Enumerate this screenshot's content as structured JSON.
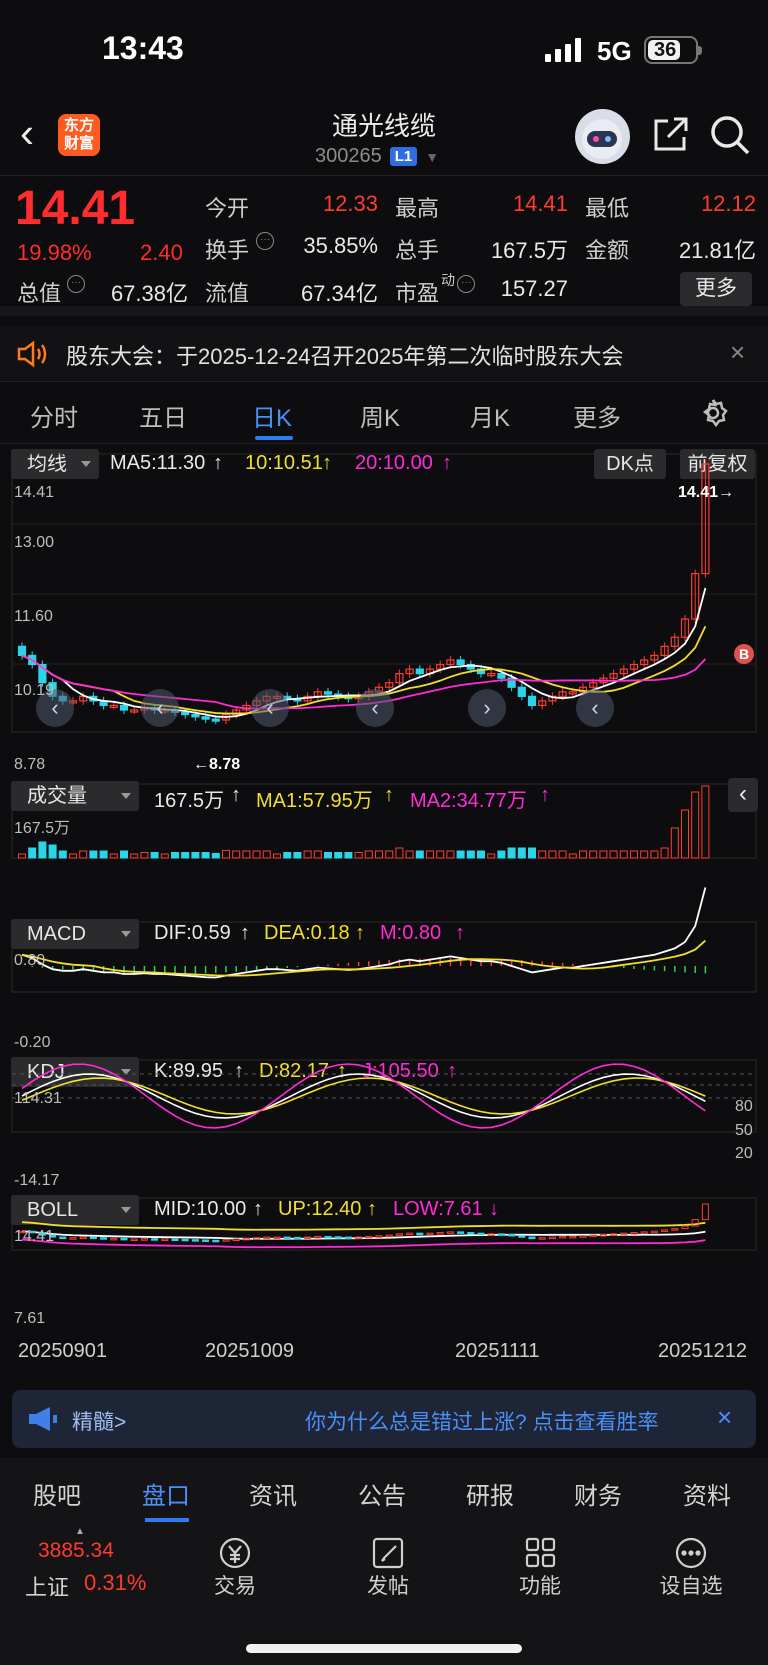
{
  "status": {
    "time": "13:43",
    "network": "5G",
    "battery": "36"
  },
  "header": {
    "title": "通光线缆",
    "code": "300265",
    "level": "L1",
    "logo_line1": "东方",
    "logo_line2": "财富"
  },
  "quote": {
    "price": "14.41",
    "pct": "19.98%",
    "change": "2.40",
    "labels": {
      "open": "今开",
      "high": "最高",
      "low": "最低",
      "turnover": "换手",
      "volume": "总手",
      "amount": "金额",
      "mktcap": "总值",
      "float": "流值",
      "pe": "市盈",
      "pe_sup": "动"
    },
    "values": {
      "open": "12.33",
      "high": "14.41",
      "low": "12.12",
      "turnover": "35.85%",
      "volume": "167.5万",
      "amount": "21.81亿",
      "mktcap": "67.38亿",
      "float": "67.34亿",
      "pe": "157.27"
    },
    "more": "更多"
  },
  "notice": {
    "text": "股东大会：于2025-12-24召开2025年第二次临时股东大会",
    "close": "×"
  },
  "tabs": [
    "分时",
    "五日",
    "日K",
    "周K",
    "月K",
    "更多"
  ],
  "tabs_active": 2,
  "kline": {
    "selector": "均线",
    "ma5": "MA5:11.30",
    "ma10": "10:10.51",
    "ma20": "20:10.00",
    "arrow": "↑",
    "dk": "DK点",
    "adj": "前复权",
    "y_top": "14.41",
    "y_mid1": "13.00",
    "y_mid2": "11.60",
    "y_mid3": "10.19",
    "y_bottom": "8.78",
    "hi_mark": "14.41",
    "lo_mark": "8.78",
    "b_mark": "B"
  },
  "volume": {
    "selector": "成交量",
    "vol": "167.5万",
    "ma1": "MA1:57.95万",
    "ma2": "MA2:34.77万",
    "y_top": "167.5万"
  },
  "macd": {
    "selector": "MACD",
    "dif": "DIF:0.59",
    "dea": "DEA:0.18",
    "m": "M:0.80",
    "y_top": "0.80",
    "y_bottom": "-0.20"
  },
  "kdj": {
    "selector": "KDJ",
    "k": "K:89.95",
    "d": "D:82.17",
    "j": "J:105.50",
    "y_top": "114.31",
    "y_bottom": "-14.17",
    "lv80": "80",
    "lv50": "50",
    "lv20": "20"
  },
  "boll": {
    "selector": "BOLL",
    "mid": "MID:10.00",
    "up": "UP:12.40",
    "low": "LOW:7.61",
    "low_arrow": "↓",
    "y_top": "14.41",
    "y_bottom": "7.61"
  },
  "dates": [
    "20250901",
    "20251009",
    "20251111",
    "20251212"
  ],
  "ad": {
    "left": "精髓>",
    "right": "你为什么总是错过上涨? 点击查看胜率",
    "close": "×"
  },
  "bottom_tabs": [
    "股吧",
    "盘口",
    "资讯",
    "公告",
    "研报",
    "财务",
    "资料"
  ],
  "bottom_tabs_active": 1,
  "bottom": {
    "index_value": "3885.34",
    "index_name": "上证",
    "index_pct": "0.31%",
    "actions": [
      "交易",
      "发帖",
      "功能",
      "设自选"
    ]
  },
  "colors": {
    "up": "#ff3b30",
    "down": "#2bd4e6",
    "ma5": "#ffffff",
    "ma10": "#f2df2c",
    "ma20": "#ff2bd7",
    "accent": "#2c7cf6"
  }
}
